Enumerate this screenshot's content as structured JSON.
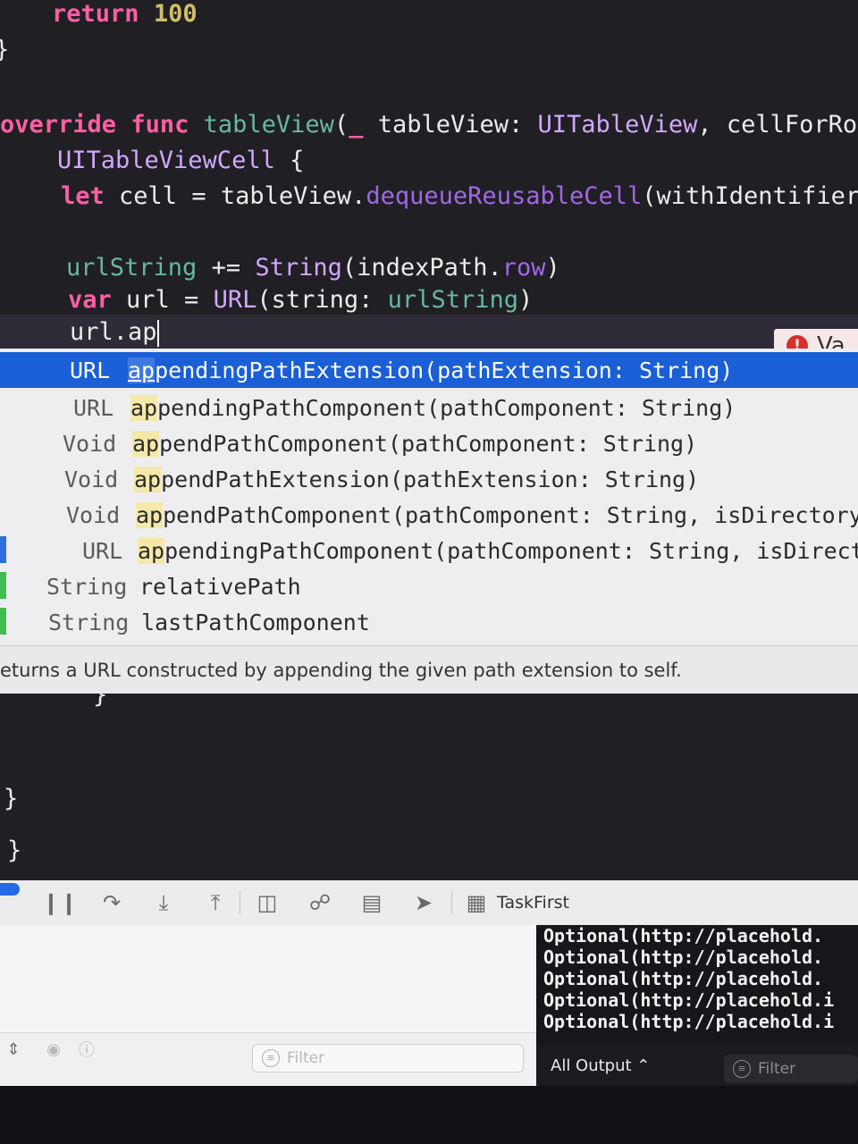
{
  "editor": {
    "line_return_kw": "return",
    "line_return_num": "100",
    "brace_close_1": "}",
    "l_override": "override",
    "l_func": "func",
    "l_fname": "tableView",
    "l_paren": "(",
    "l_underscore": "_",
    "l_param": " tableView: ",
    "l_uitableview": "UITableView",
    "l_rest": ", cellForRo",
    "l2_type": "UITableViewCell",
    "l2_brace": " {",
    "l3_let": "let",
    "l3_cell": " cell = tableView.",
    "l3_method": "dequeueReusableCell",
    "l3_rest": "(withIdentifier",
    "l4_var": "urlString",
    "l4_op": " += ",
    "l4_string": "String",
    "l4_open": "(indexPath.",
    "l4_row": "row",
    "l4_close": ")",
    "l5_var_kw": "var",
    "l5_url": " url = ",
    "l5_URL": "URL",
    "l5_mid": "(string: ",
    "l5_urlstring": "urlString",
    "l5_close": ")",
    "l6_text": "url.ap",
    "error_text": "Va",
    "brace_inner": "}",
    "brace_close_2": "}",
    "brace_close_3": "}"
  },
  "autocomplete": {
    "items": [
      {
        "type": "URL",
        "match": "ap",
        "rest": "pendingPathExtension(pathExtension: String)",
        "selected": true
      },
      {
        "type": "URL",
        "match": "ap",
        "rest": "pendingPathComponent(pathComponent: String)"
      },
      {
        "type": "Void",
        "match": "ap",
        "rest": "pendPathComponent(pathComponent: String)"
      },
      {
        "type": "Void",
        "match": "ap",
        "rest": "pendPathExtension(pathExtension: String)"
      },
      {
        "type": "Void",
        "match": "ap",
        "rest": "pendPathComponent(pathComponent: String, isDirectory"
      },
      {
        "type": "URL",
        "match": "ap",
        "rest": "pendingPathComponent(pathComponent: String, isDirect"
      },
      {
        "type": "String",
        "match": "",
        "rest": "relativePath"
      },
      {
        "type": "String",
        "match": "",
        "rest": "lastPathComponent"
      }
    ],
    "description": "eturns a URL constructed by appending the given path extension to self."
  },
  "debugbar": {
    "scheme": "TaskFirst"
  },
  "debug_area": {
    "vars_filter_placeholder": "Filter",
    "console_lines": [
      "Optional(http://placehold.",
      "Optional(http://placehold.",
      "Optional(http://placehold.",
      "Optional(http://placehold.i",
      "Optional(http://placehold.i"
    ],
    "output_selector": "All Output ⌃",
    "console_filter_placeholder": "Filter"
  }
}
